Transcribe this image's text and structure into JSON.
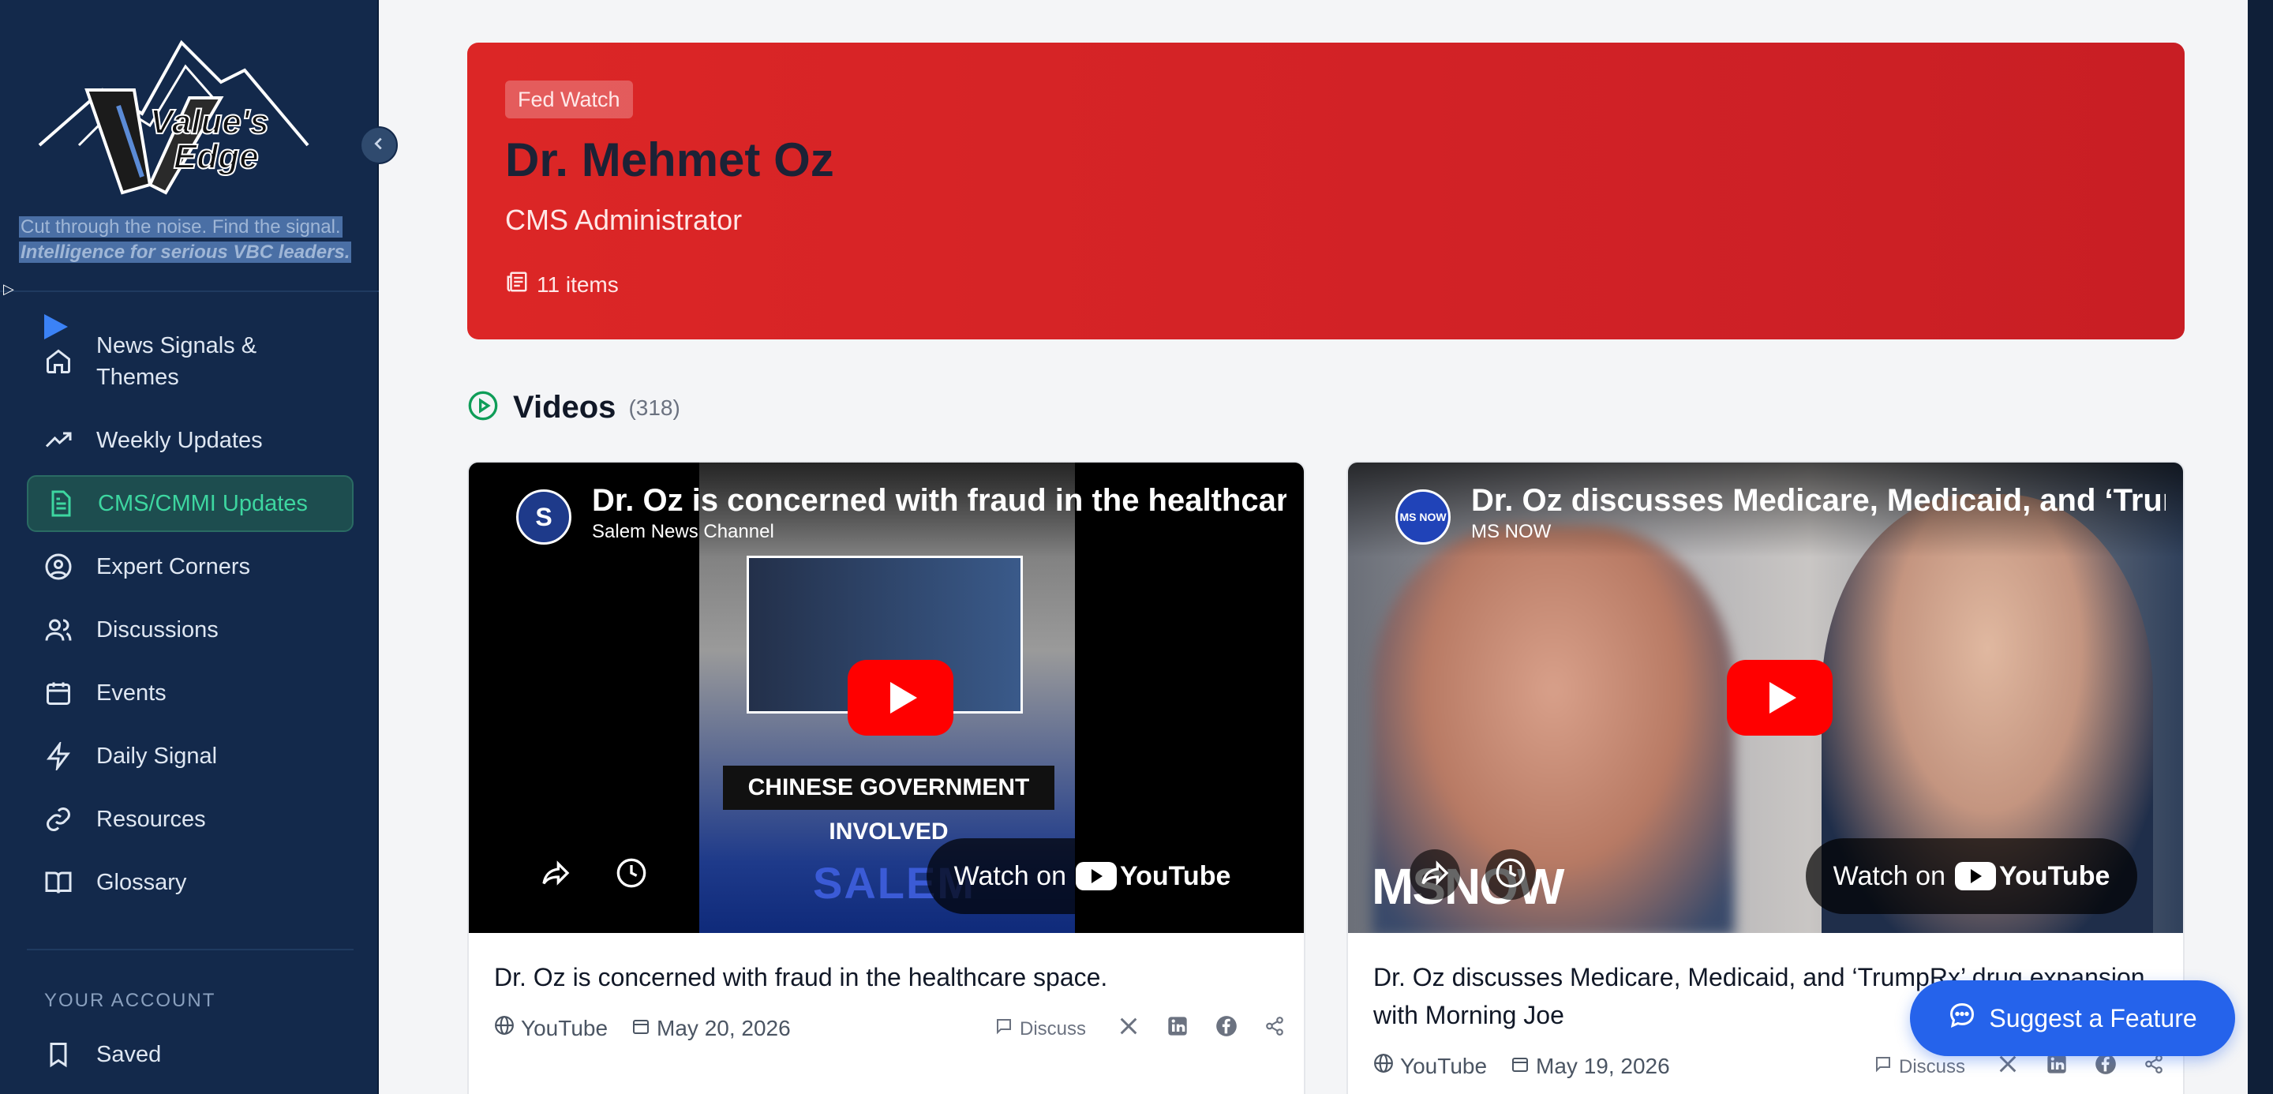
{
  "sidebar": {
    "brand_line1": "Value's",
    "brand_line2": "Edge",
    "tagline1": "Cut through the noise. Find the signal.",
    "tagline2": "Intelligence for serious VBC leaders.",
    "items": [
      {
        "label": "News Signals & Themes",
        "icon": "home-icon"
      },
      {
        "label": "Weekly Updates",
        "icon": "trending-up-icon"
      },
      {
        "label": "CMS/CMMI Updates",
        "icon": "document-icon"
      },
      {
        "label": "Expert Corners",
        "icon": "user-circle-icon"
      },
      {
        "label": "Discussions",
        "icon": "users-icon"
      },
      {
        "label": "Events",
        "icon": "calendar-icon"
      },
      {
        "label": "Daily Signal",
        "icon": "lightning-icon"
      },
      {
        "label": "Resources",
        "icon": "link-icon"
      },
      {
        "label": "Glossary",
        "icon": "book-icon"
      }
    ],
    "account_label": "YOUR ACCOUNT",
    "account_items": [
      {
        "label": "Saved",
        "icon": "bookmark-icon"
      }
    ]
  },
  "hero": {
    "tag": "Fed Watch",
    "title": "Dr. Mehmet Oz",
    "subtitle": "CMS Administrator",
    "count": "11 items"
  },
  "videos": {
    "title": "Videos",
    "count": "(318)",
    "cards": [
      {
        "yt_title": "Dr. Oz is concerned with fraud in the healthcare space.",
        "channel": "Salem News Channel",
        "channel_avatar": "S",
        "watch_on": "Watch on",
        "yt_brand": "YouTube",
        "overlay_text": "CHINESE GOVERNMENT INVOLVED",
        "watermark": "SALEM",
        "title": "Dr. Oz is concerned with fraud in the healthcare space.",
        "source": "YouTube",
        "date": "May 20, 2026",
        "discuss": "Discuss"
      },
      {
        "yt_title": "Dr. Oz discusses Medicare, Medicaid, and ‘TrumpRx’ drug expansion with Morning Joe",
        "channel": "MS NOW",
        "channel_avatar": "MS NOW",
        "watch_on": "Watch on",
        "yt_brand": "YouTube",
        "watermark": "MSNOW",
        "title": "Dr. Oz discusses Medicare, Medicaid, and ‘TrumpRx’ drug expansion with Morning Joe",
        "source": "YouTube",
        "date": "May 19, 2026",
        "discuss": "Discuss"
      }
    ]
  },
  "suggest_label": "Suggest a Feature"
}
